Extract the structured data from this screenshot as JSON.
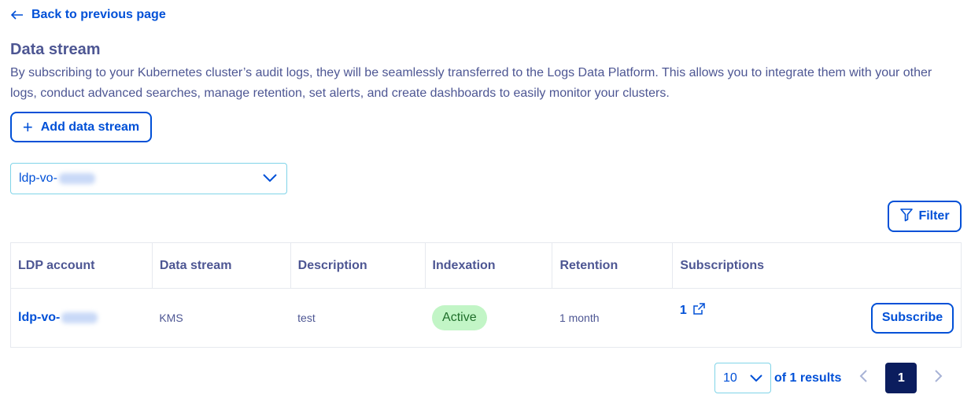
{
  "nav": {
    "back_label": "Back to previous page"
  },
  "header": {
    "title": "Data stream",
    "description": "By subscribing to your Kubernetes cluster’s audit logs, they will be seamlessly transferred to the Logs Data Platform. This allows you to integrate them with your other logs, conduct advanced searches, manage retention, set alerts, and create dashboards to easily monitor your clusters."
  },
  "actions": {
    "add_label": "Add data stream",
    "filter_label": "Filter"
  },
  "account_select": {
    "value_prefix": "ldp-vo-"
  },
  "table": {
    "columns": [
      "LDP account",
      "Data stream",
      "Description",
      "Indexation",
      "Retention",
      "Subscriptions"
    ],
    "rows": [
      {
        "ldp_account_prefix": "ldp-vo-",
        "data_stream": "KMS",
        "description": "test",
        "indexation": "Active",
        "retention": "1 month",
        "subscriptions": "1",
        "action_label": "Subscribe"
      }
    ]
  },
  "pagination": {
    "page_size": "10",
    "results_text": "of 1 results",
    "current_page": "1"
  },
  "colors": {
    "primary": "#0050d7",
    "text": "#4d5693",
    "active_badge": "#c2f5c6",
    "current_page_bg": "#0b1d5e"
  }
}
